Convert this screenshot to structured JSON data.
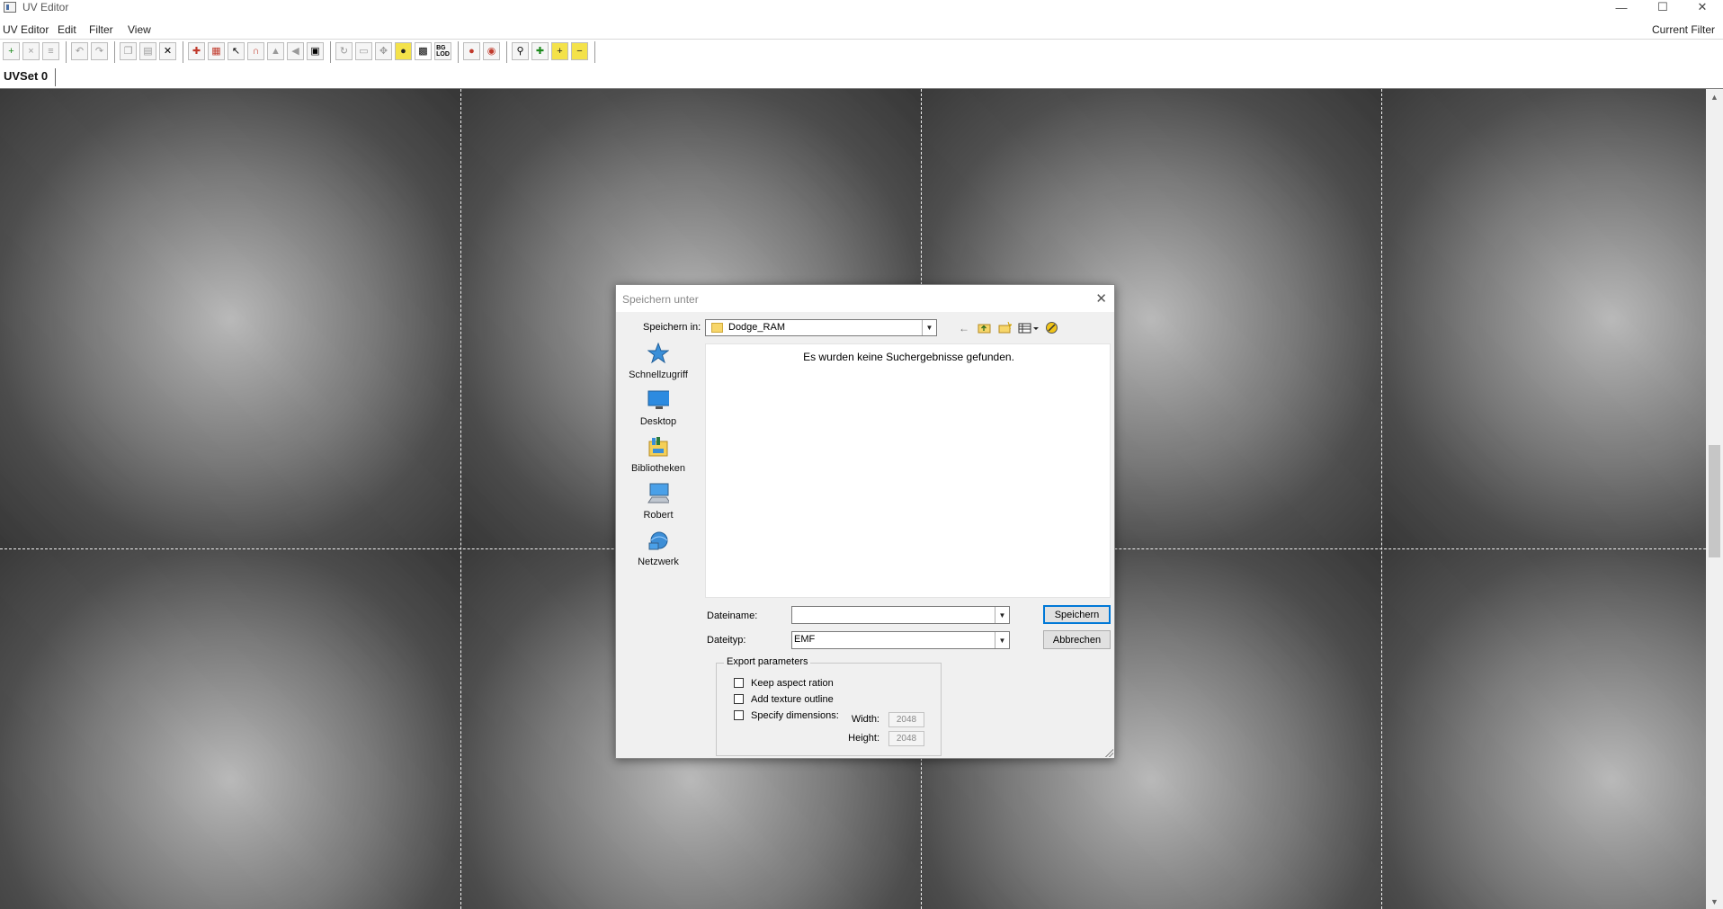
{
  "window": {
    "title": "UV Editor"
  },
  "menu": {
    "items": [
      "UV Editor",
      "Edit",
      "Filter",
      "View"
    ],
    "right_label": "Current Filter"
  },
  "tabs": {
    "active": "UVSet 0"
  },
  "dialog": {
    "title": "Speichern unter",
    "look_in_label": "Speichern in:",
    "look_in_value": "Dodge_RAM",
    "places": [
      "Schnellzugriff",
      "Desktop",
      "Bibliotheken",
      "Robert",
      "Netzwerk"
    ],
    "empty_message": "Es wurden keine Suchergebnisse gefunden.",
    "filename_label": "Dateiname:",
    "filename_value": "",
    "filetype_label": "Dateityp:",
    "filetype_value": "EMF",
    "save_button": "Speichern",
    "cancel_button": "Abbrechen",
    "export": {
      "title": "Export parameters",
      "keep_aspect": "Keep aspect ration",
      "add_outline": "Add texture outline",
      "specify_dims": "Specify dimensions:",
      "width_label": "Width:",
      "height_label": "Height:",
      "width_value": "2048",
      "height_value": "2048"
    }
  },
  "colors": {
    "accent": "#0078d7",
    "dialog_bg": "#f0f0f0",
    "folder": "#f7d66a"
  }
}
